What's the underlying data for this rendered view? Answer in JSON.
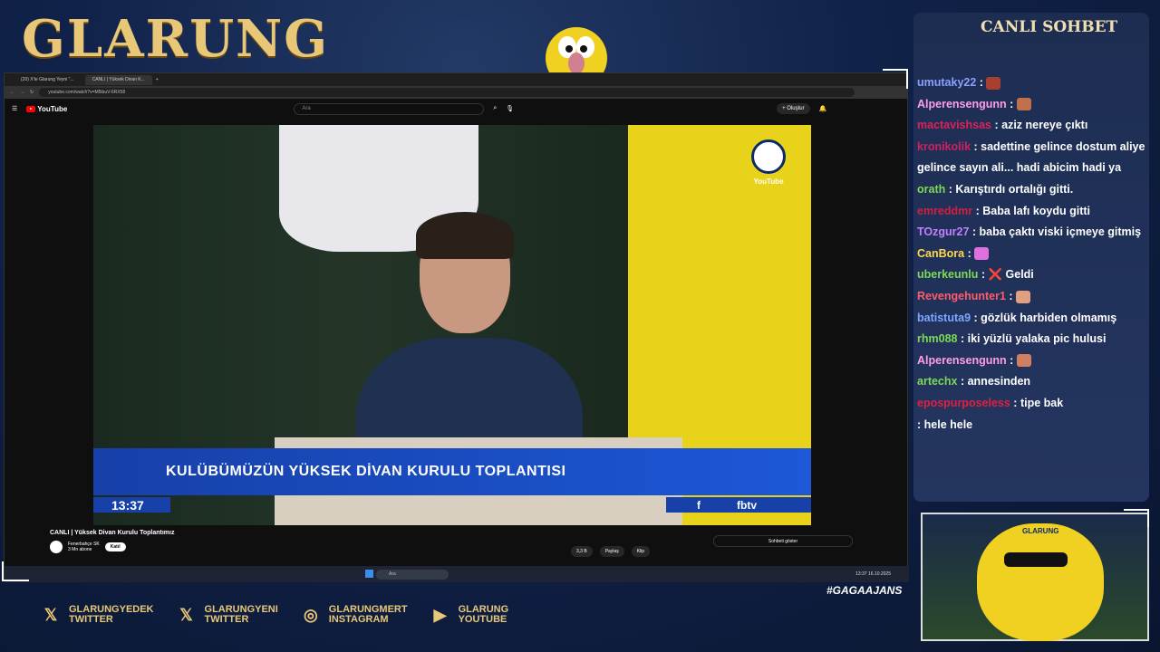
{
  "overlay": {
    "brand": "GLARUNG",
    "hashtag": "#GAGAAJANS"
  },
  "browser": {
    "tabs": [
      "(20) X'te Glarung Yeyni \"...",
      "CANLI | Yüksek Divan K..."
    ],
    "url": "youtube.com/watch?v=M5ibuV-6RX58",
    "yt_logo": "YouTube",
    "search_placeholder": "Ara",
    "create_label": "Oluştur",
    "video": {
      "banner": "KULÜBÜMÜZÜN YÜKSEK DİVAN KURULU TOPLANTISI",
      "clock": "13:37",
      "network": "fbtv",
      "crest_caption": "YouTube"
    },
    "meta": {
      "title": "CANLI | Yüksek Divan Kurulu Toplantımız",
      "channel": "Fenerbahçe SK",
      "subs": "3 Mn abone",
      "join": "Katıl"
    },
    "actions": [
      "3,3 B",
      "Paylaş",
      "Klip"
    ],
    "chat_toggle": "Sohbeti göster",
    "taskbar": {
      "search": "Ara",
      "time": "13:37",
      "date": "16.10.2025"
    }
  },
  "chat": {
    "title": "CANLI SOHBET",
    "messages": [
      {
        "user": "umutaky22",
        "text": "",
        "color": "#8aa0ff",
        "emote": "#a84030"
      },
      {
        "user": "Alperensengunn",
        "text": "",
        "color": "#ff9ee6",
        "emote": "#c0704a"
      },
      {
        "user": "mactavishsas",
        "text": "aziz nereye çıktı",
        "color": "#e0205a"
      },
      {
        "user": "kronikolik",
        "text": "sadettine gelince dostum aliye gelince sayın ali... hadi abicim hadi ya",
        "color": "#d02060"
      },
      {
        "user": "orath",
        "text": "Karıştırdı ortalığı gitti.",
        "color": "#7ed957"
      },
      {
        "user": "emreddmr",
        "text": "Baba lafı koydu gitti",
        "color": "#d02040"
      },
      {
        "user": "TOzgur27",
        "text": "baba çaktı viski içmeye gitmiş",
        "color": "#c080ff"
      },
      {
        "user": "CanBora",
        "text": "",
        "color": "#ffd84a",
        "emote": "#e070e0"
      },
      {
        "user": "uberkeunlu",
        "text": "❌ Geldi",
        "color": "#7ed957"
      },
      {
        "user": "Revengehunter1",
        "text": "",
        "color": "#ff5c6a",
        "emote": "#e0a080"
      },
      {
        "user": "batistuta9",
        "text": "gözlük harbiden olmamış",
        "color": "#7aa8ff"
      },
      {
        "user": "rhm088",
        "text": "iki yüzlü yalaka pic hulusi",
        "color": "#7ed957"
      },
      {
        "user": "Alperensengunn",
        "text": "",
        "color": "#ff9ee6",
        "emote": "#d08060"
      },
      {
        "user": "artechx",
        "text": "annesinden",
        "color": "#7ed957"
      },
      {
        "user": "epospurposeless",
        "text": "tipe bak",
        "color": "#e02040"
      },
      {
        "user": "",
        "text": "hele hele",
        "color": "#ffffff"
      }
    ]
  },
  "cam": {
    "cap": "GLARUNG"
  },
  "socials": [
    {
      "icon": "x-icon",
      "glyph": "𝕏",
      "line1": "GLARUNGYEDEK",
      "line2": "TWITTER"
    },
    {
      "icon": "x-icon",
      "glyph": "𝕏",
      "line1": "GLARUNGYENI",
      "line2": "TWITTER"
    },
    {
      "icon": "instagram-icon",
      "glyph": "◎",
      "line1": "GLARUNGMERT",
      "line2": "INSTAGRAM"
    },
    {
      "icon": "youtube-icon",
      "glyph": "▶",
      "line1": "GLARUNG",
      "line2": "YOUTUBE"
    }
  ]
}
